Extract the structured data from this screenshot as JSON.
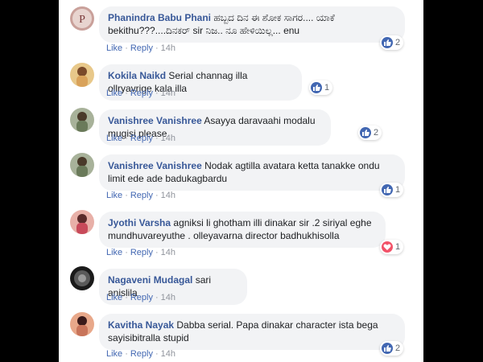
{
  "comments": [
    {
      "author": "Phanindra Babu Phani",
      "text": "ಹಬ್ಬದ ದಿನ ಈ ಶೋಕ ಸಾಗರ.... ಯಾಕೆ bekithu???....ದಿನಕರ್ sir ನಿಜ.. ನೂ ಹೇಳಿಯಿಲ್ಲ... enu",
      "like": "Like",
      "reply": "Reply",
      "time": "14h",
      "reaction": "like-icon",
      "count": "2",
      "avatar_color": "#c9a09a",
      "avatar_letter": "P"
    },
    {
      "author": "Kokila Naikd",
      "text": "Serial channag illa ollryavrige kala illa",
      "like": "Like",
      "reply": "Reply",
      "time": "14h",
      "reaction": "like-icon",
      "count": "1",
      "avatar_color": "#d9a25a"
    },
    {
      "author": "Vanishree Vanishree",
      "text": "Asayya daravaahi modalu mugisi please",
      "like": "Like",
      "reply": "Reply",
      "time": "14h",
      "reaction": "like-icon",
      "count": "2",
      "avatar_color": "#7a8a6a"
    },
    {
      "author": "Vanishree Vanishree",
      "text": "Nodak agtilla avatara ketta tanakke ondu limit ede ade badukagbardu",
      "like": "Like",
      "reply": "Reply",
      "time": "14h",
      "reaction": "like-icon",
      "count": "1",
      "avatar_color": "#7a8a6a"
    },
    {
      "author": "Jyothi Varsha",
      "text": "agniksi li ghotham illi dinakar sir .2 siriyal eghe mundhuvareyuthe . olleyavarna director badhukhisolla",
      "like": "Like",
      "reply": "Reply",
      "time": "14h",
      "reaction": "love-icon",
      "count": "1",
      "avatar_color": "#c86a6a"
    },
    {
      "author": "Nagaveni Mudagal",
      "text": "sari anislila",
      "like": "Like",
      "reply": "Reply",
      "time": "14h",
      "avatar_color": "#3a3a3a"
    },
    {
      "author": "Kavitha Nayak",
      "text": "Dabba serial. Papa dinakar character ista bega sayisibitralla stupid",
      "like": "Like",
      "reply": "Reply",
      "time": "14h",
      "reaction": "like-icon",
      "count": "2",
      "avatar_color": "#c8745a"
    }
  ],
  "colors": {
    "author": "#385898",
    "bubble": "#f2f3f5",
    "link": "#4267b2",
    "meta": "#90949c",
    "like": "#4267b2",
    "love": "#f25268"
  }
}
